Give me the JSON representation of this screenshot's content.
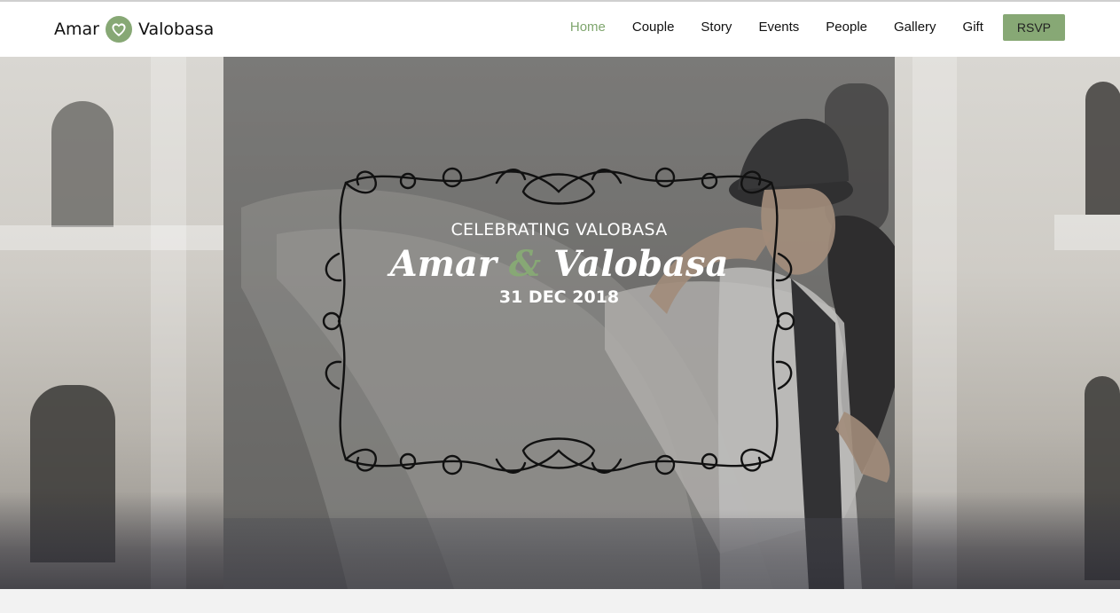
{
  "header": {
    "brand_first": "Amar",
    "brand_icon": "heart-icon",
    "brand_second": "Valobasa",
    "nav": [
      {
        "label": "Home",
        "active": true
      },
      {
        "label": "Couple",
        "active": false
      },
      {
        "label": "Story",
        "active": false
      },
      {
        "label": "Events",
        "active": false
      },
      {
        "label": "People",
        "active": false
      },
      {
        "label": "Gallery",
        "active": false
      },
      {
        "label": "Gift",
        "active": false
      }
    ],
    "rsvp_label": "RSVP"
  },
  "hero": {
    "eyebrow": "CELEBRATING VALOBASA",
    "name_first": "Amar",
    "ampersand": "&",
    "name_second": "Valobasa",
    "date": "31 DEC 2018",
    "frame_icon": "ornamental-frame-icon"
  },
  "colors": {
    "accent": "#87a875",
    "active_nav": "#7fa66e",
    "header_bg": "#ffffff",
    "text": "#111111"
  }
}
